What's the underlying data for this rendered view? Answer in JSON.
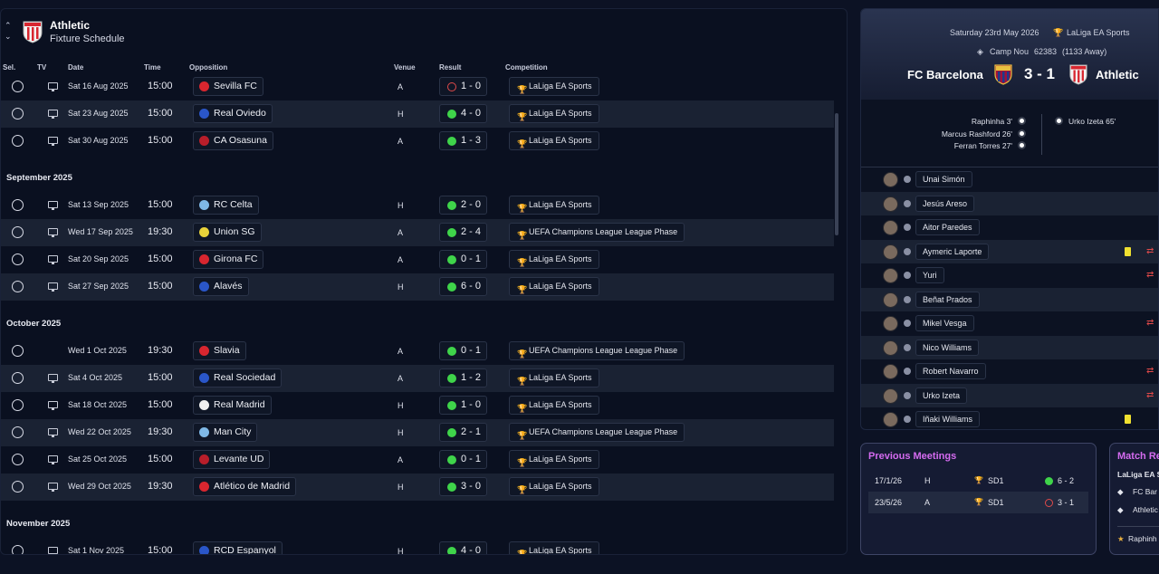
{
  "header": {
    "title": "Athletic",
    "subtitle": "Fixture Schedule"
  },
  "columns": {
    "sel": "Sel.",
    "tv": "TV",
    "date": "Date",
    "time": "Time",
    "opposition": "Opposition",
    "venue": "Venue",
    "result": "Result",
    "competition": "Competition"
  },
  "fixtures": [
    {
      "date": "Sat 16 Aug 2025",
      "time": "15:00",
      "opp": "Sevilla FC",
      "venue": "A",
      "score": "1 - 0",
      "outcome": "loss",
      "comp": "LaLiga EA Sports",
      "tv": true,
      "color": "#d8262f"
    },
    {
      "date": "Sat 23 Aug 2025",
      "time": "15:00",
      "opp": "Real Oviedo",
      "venue": "H",
      "score": "4 - 0",
      "outcome": "win",
      "comp": "LaLiga EA Sports",
      "tv": true,
      "color": "#2a56c8"
    },
    {
      "date": "Sat 30 Aug 2025",
      "time": "15:00",
      "opp": "CA Osasuna",
      "venue": "A",
      "score": "1 - 3",
      "outcome": "win",
      "comp": "LaLiga EA Sports",
      "tv": true,
      "color": "#b81e2a"
    },
    {
      "section": "September 2025"
    },
    {
      "date": "Sat 13 Sep 2025",
      "time": "15:00",
      "opp": "RC Celta",
      "venue": "H",
      "score": "2 - 0",
      "outcome": "win",
      "comp": "LaLiga EA Sports",
      "tv": true,
      "color": "#7fb8e6"
    },
    {
      "date": "Wed 17 Sep 2025",
      "time": "19:30",
      "opp": "Union SG",
      "venue": "A",
      "score": "2 - 4",
      "outcome": "win",
      "comp": "UEFA Champions League League Phase",
      "tv": true,
      "color": "#e8d23a"
    },
    {
      "date": "Sat 20 Sep 2025",
      "time": "15:00",
      "opp": "Girona FC",
      "venue": "A",
      "score": "0 - 1",
      "outcome": "win",
      "comp": "LaLiga EA Sports",
      "tv": true,
      "color": "#d8262f"
    },
    {
      "date": "Sat 27 Sep 2025",
      "time": "15:00",
      "opp": "Alavés",
      "venue": "H",
      "score": "6 - 0",
      "outcome": "win",
      "comp": "LaLiga EA Sports",
      "tv": true,
      "color": "#2a56c8"
    },
    {
      "section": "October 2025"
    },
    {
      "date": "Wed 1 Oct 2025",
      "time": "19:30",
      "opp": "Slavia",
      "venue": "A",
      "score": "0 - 1",
      "outcome": "win",
      "comp": "UEFA Champions League League Phase",
      "tv": false,
      "color": "#d8262f"
    },
    {
      "date": "Sat 4 Oct 2025",
      "time": "15:00",
      "opp": "Real Sociedad",
      "venue": "A",
      "score": "1 - 2",
      "outcome": "win",
      "comp": "LaLiga EA Sports",
      "tv": true,
      "color": "#2a56c8"
    },
    {
      "date": "Sat 18 Oct 2025",
      "time": "15:00",
      "opp": "Real Madrid",
      "venue": "H",
      "score": "1 - 0",
      "outcome": "win",
      "comp": "LaLiga EA Sports",
      "tv": true,
      "color": "#f0f0f0"
    },
    {
      "date": "Wed 22 Oct 2025",
      "time": "19:30",
      "opp": "Man City",
      "venue": "H",
      "score": "2 - 1",
      "outcome": "win",
      "comp": "UEFA Champions League League Phase",
      "tv": true,
      "color": "#7fb8e6"
    },
    {
      "date": "Sat 25 Oct 2025",
      "time": "15:00",
      "opp": "Levante UD",
      "venue": "A",
      "score": "0 - 1",
      "outcome": "win",
      "comp": "LaLiga EA Sports",
      "tv": true,
      "color": "#b81e2a"
    },
    {
      "date": "Wed 29 Oct 2025",
      "time": "19:30",
      "opp": "Atlético de Madrid",
      "venue": "H",
      "score": "3 - 0",
      "outcome": "win",
      "comp": "LaLiga EA Sports",
      "tv": true,
      "color": "#d8262f"
    },
    {
      "section": "November 2025"
    },
    {
      "date": "Sat 1 Nov 2025",
      "time": "15:00",
      "opp": "RCD Espanyol",
      "venue": "H",
      "score": "4 - 0",
      "outcome": "win",
      "comp": "LaLiga EA Sports",
      "tv": true,
      "color": "#2a56c8"
    }
  ],
  "match": {
    "date": "Saturday 23rd May 2026",
    "competition": "LaLiga EA Sports",
    "stadium": "Camp Nou",
    "attendance": "62383",
    "away_count": "(1133 Away)",
    "home": "FC Barcelona",
    "away": "Athletic",
    "score": "3 - 1",
    "home_scorers": [
      "Raphinha 3'",
      "Marcus Rashford 26'",
      "Ferran Torres 27'"
    ],
    "away_scorers": [
      "Urko Izeta 65'"
    ]
  },
  "lineup": [
    {
      "name": "Unai Simón",
      "yellow": false,
      "sub": false
    },
    {
      "name": "Jesús Areso",
      "yellow": false,
      "sub": false
    },
    {
      "name": "Aitor Paredes",
      "yellow": false,
      "sub": false
    },
    {
      "name": "Aymeric Laporte",
      "yellow": true,
      "sub": true
    },
    {
      "name": "Yuri",
      "yellow": false,
      "sub": true
    },
    {
      "name": "Beñat Prados",
      "yellow": false,
      "sub": false
    },
    {
      "name": "Mikel Vesga",
      "yellow": false,
      "sub": true
    },
    {
      "name": "Nico Williams",
      "yellow": false,
      "sub": false
    },
    {
      "name": "Robert Navarro",
      "yellow": false,
      "sub": true
    },
    {
      "name": "Urko Izeta",
      "yellow": false,
      "sub": true
    },
    {
      "name": "Iñaki Williams",
      "yellow": true,
      "sub": false
    }
  ],
  "previous": {
    "title": "Previous Meetings",
    "rows": [
      {
        "date": "17/1/26",
        "venue": "H",
        "comp": "SD1",
        "score": "6 - 2",
        "outcome": "win"
      },
      {
        "date": "23/5/26",
        "venue": "A",
        "comp": "SD1",
        "score": "3 - 1",
        "outcome": "loss"
      }
    ]
  },
  "report": {
    "title": "Match Report",
    "comp": "LaLiga EA S",
    "home": "FC Bar",
    "away": "Athletic",
    "motm": "Raphinh"
  }
}
